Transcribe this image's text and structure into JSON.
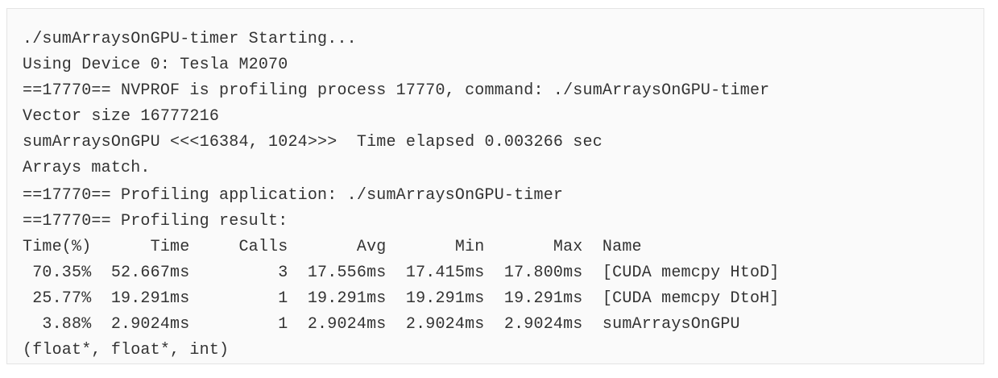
{
  "terminal": {
    "lines": [
      "./sumArraysOnGPU-timer Starting...",
      "Using Device 0: Tesla M2070",
      "==17770== NVPROF is profiling process 17770, command: ./sumArraysOnGPU-timer",
      "Vector size 16777216",
      "sumArraysOnGPU <<<16384, 1024>>>  Time elapsed 0.003266 sec",
      "Arrays match.",
      "==17770== Profiling application: ./sumArraysOnGPU-timer",
      "==17770== Profiling result:",
      "Time(%)      Time     Calls       Avg       Min       Max  Name",
      " 70.35%  52.667ms         3  17.556ms  17.415ms  17.800ms  [CUDA memcpy HtoD]",
      " 25.77%  19.291ms         1  19.291ms  19.291ms  19.291ms  [CUDA memcpy DtoH]",
      "  3.88%  2.9024ms         1  2.9024ms  2.9024ms  2.9024ms  sumArraysOnGPU",
      "(float*, float*, int)"
    ]
  }
}
